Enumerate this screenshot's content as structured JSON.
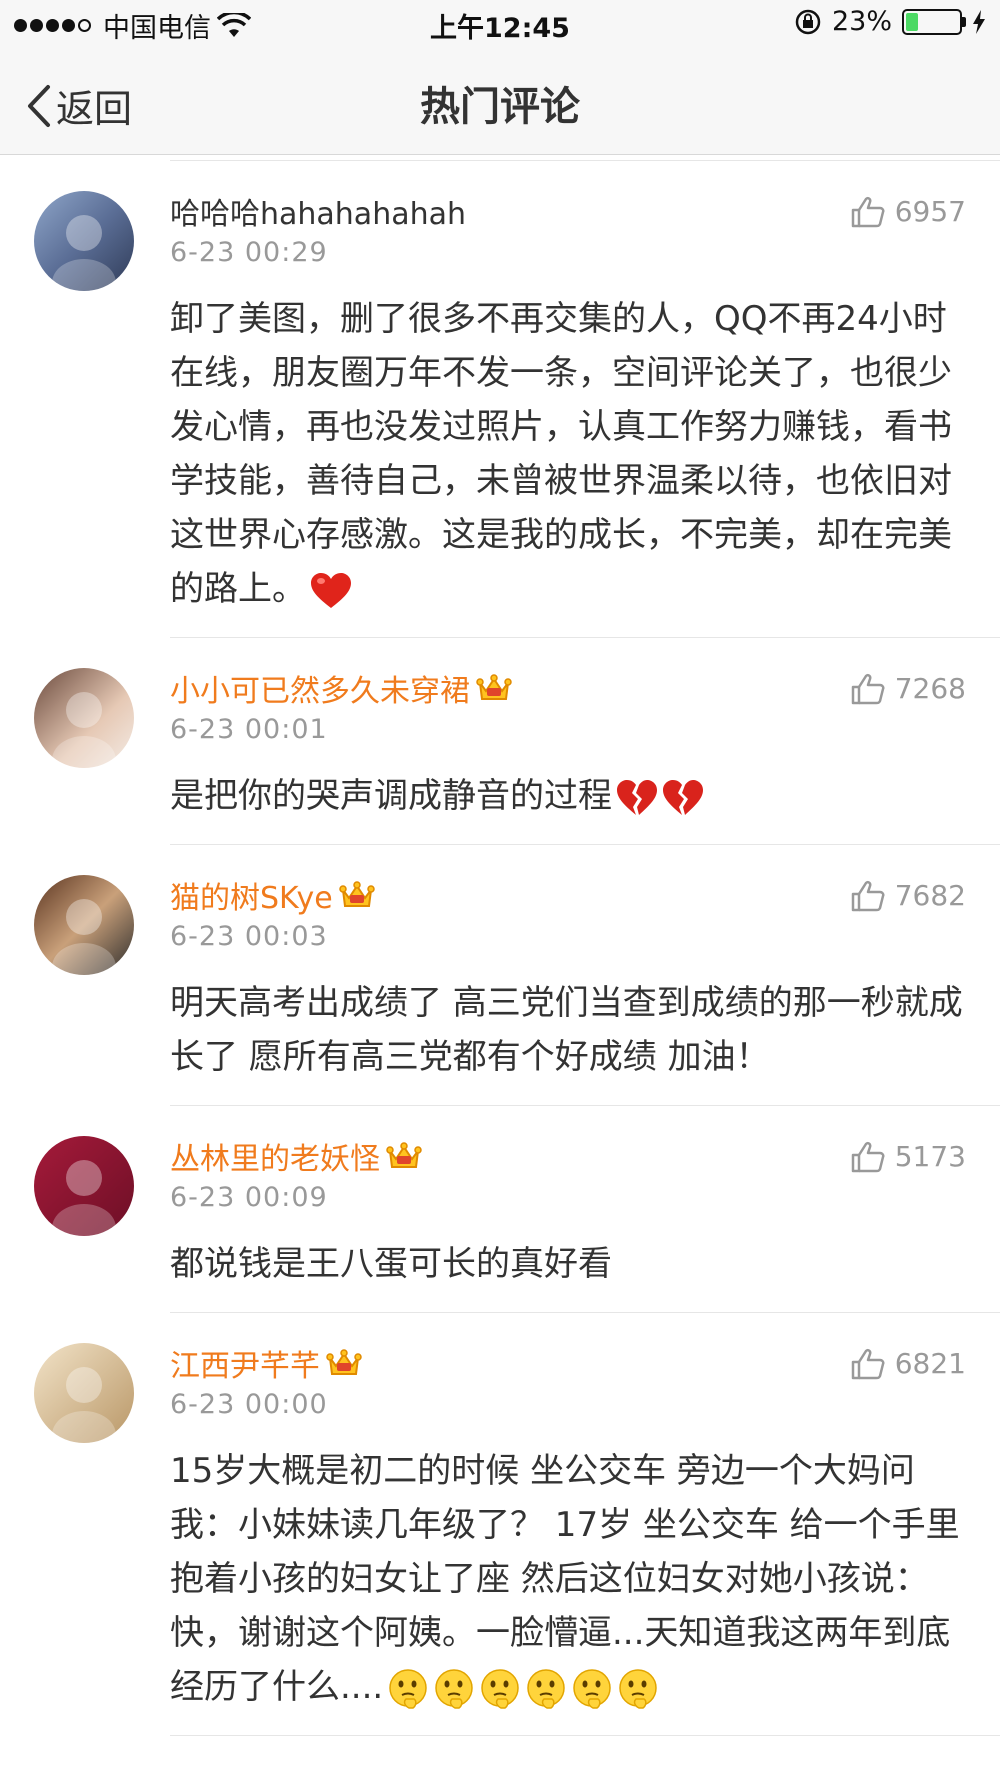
{
  "status_bar": {
    "carrier": "中国电信",
    "time": "上午12:45",
    "battery_percent": "23%",
    "battery_level": 0.23,
    "icons": [
      "signal-dots",
      "wifi-icon",
      "rotation-lock-icon",
      "battery-icon",
      "charging-icon"
    ]
  },
  "nav": {
    "back_label": "返回",
    "title": "热门评论"
  },
  "comments": [
    {
      "name": "哈哈哈hahahahahah",
      "vip": false,
      "date": "6-23 00:29",
      "likes": "6957",
      "text": "卸了美图，删了很多不再交集的人，QQ不再24小时在线，朋友圈万年不发一条，空间评论关了，也很少发心情，再也没发过照片，认真工作努力赚钱，看书学技能，善待自己，未曾被世界温柔以待，也依旧对这世界心存感激。这是我的成长，不完美，却在完美的路上。",
      "emojis": [
        "heart-emoji"
      ]
    },
    {
      "name": "小小可已然多久未穿裙",
      "vip": true,
      "date": "6-23 00:01",
      "likes": "7268",
      "text": "是把你的哭声调成静音的过程",
      "emojis": [
        "broken-heart-emoji",
        "broken-heart-emoji"
      ]
    },
    {
      "name": "猫的树SKye",
      "vip": true,
      "date": "6-23 00:03",
      "likes": "7682",
      "text": "明天高考出成绩了  高三党们当查到成绩的那一秒就成长了  愿所有高三党都有个好成绩  加油！",
      "emojis": []
    },
    {
      "name": "丛林里的老妖怪",
      "vip": true,
      "date": "6-23 00:09",
      "likes": "5173",
      "text": "都说钱是王八蛋可长的真好看",
      "emojis": []
    },
    {
      "name": "江西尹芊芊",
      "vip": true,
      "date": "6-23 00:00",
      "likes": "6821",
      "text": "15岁大概是初二的时候 坐公交车 旁边一个大妈问我：小妹妹读几年级了？  17岁 坐公交车 给一个手里抱着小孩的妇女让了座 然后这位妇女对她小孩说：快，谢谢这个阿姨。一脸懵逼...天知道我这两年到底经历了什么....",
      "emojis": [
        "thinking-emoji",
        "thinking-emoji",
        "thinking-emoji",
        "thinking-emoji",
        "thinking-emoji",
        "thinking-emoji"
      ]
    }
  ],
  "colors": {
    "vip_name": "#f07b1d",
    "meta_gray": "#999999",
    "bar_bg": "#f7f7f7"
  }
}
